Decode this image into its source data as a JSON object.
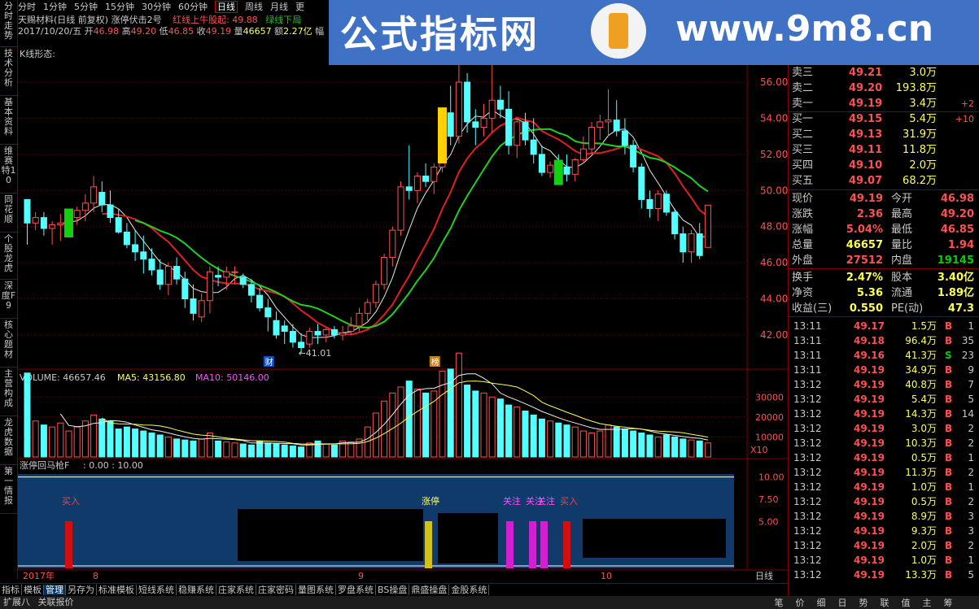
{
  "left_tabs": [
    "分时走势",
    "技术分析",
    "基本资料",
    "维赛特10",
    "同花顺",
    "个股龙虎",
    "深度F9",
    "核心题材",
    "主营构成",
    "龙虎数据",
    "第一情报"
  ],
  "top_menu": [
    "分时",
    "1分钟",
    "5分钟",
    "15分钟",
    "30分钟",
    "60分钟",
    "日线",
    "周线",
    "月线",
    "更"
  ],
  "top_menu_active": 6,
  "title": "天赐材料(日线 前复权) 涨停伏击2号",
  "title_red": "红线上牛股起: 49.88",
  "title_green": "绿线下局",
  "info": {
    "date": "2017/10/20/五",
    "open_l": "开",
    "open": "46.98",
    "high_l": "高",
    "high": "49.20",
    "low_l": "低",
    "low": "46.85",
    "close_l": "收",
    "close": "49.19",
    "vol_l": "量",
    "vol": "46657",
    "amt_l": "额",
    "amt": "2.27亿",
    "amp_l": "幅"
  },
  "kform": "K线形态:",
  "banner": {
    "text1": "公式指标网",
    "text2": "www.9m8.cn"
  },
  "price_axis": [
    "56.00",
    "54.00",
    "52.00",
    "50.00",
    "48.00",
    "46.00",
    "44.00",
    "42.00"
  ],
  "annot": {
    "low_label": "←41.01",
    "cai": "财",
    "bang": "榜"
  },
  "volume_panel": {
    "vol_label": "VOLUME: 46657.46",
    "ma5": "MA5: 43156.80",
    "ma10": "MA10: 50146.00",
    "axis": [
      "30000",
      "20000",
      "10000"
    ],
    "x10": "X10"
  },
  "ind_panel": {
    "name": "涨停回马枪F",
    "values": ": 0.00 : 10.00",
    "axis": [
      "10.00",
      "7.50",
      "5.00"
    ],
    "labels": {
      "buy1": "买入",
      "zt": "涨停",
      "gz1": "关注",
      "gz2": "关注",
      "gz3": "关注",
      "buy2": "买入"
    }
  },
  "date_axis": {
    "y2017": "2017年",
    "m8": "8",
    "m9": "9",
    "m10": "10",
    "right": "日线"
  },
  "quote": {
    "sells": [
      {
        "n": "卖三",
        "p": "49.21",
        "v": "3.0万",
        "d": ""
      },
      {
        "n": "卖二",
        "p": "49.20",
        "v": "193.8万",
        "d": ""
      },
      {
        "n": "卖一",
        "p": "49.19",
        "v": "3.4万",
        "d": "+2"
      }
    ],
    "buys": [
      {
        "n": "买一",
        "p": "49.15",
        "v": "5.4万",
        "d": "+10"
      },
      {
        "n": "买二",
        "p": "49.13",
        "v": "31.9万",
        "d": ""
      },
      {
        "n": "买三",
        "p": "49.11",
        "v": "11.8万",
        "d": ""
      },
      {
        "n": "买四",
        "p": "49.10",
        "v": "2.0万",
        "d": ""
      },
      {
        "n": "买五",
        "p": "49.07",
        "v": "68.2万",
        "d": ""
      }
    ],
    "stats": [
      {
        "l1": "现价",
        "v1": "49.19",
        "c1": "#ff5050",
        "l2": "今开",
        "v2": "46.98",
        "c2": "#ff5050"
      },
      {
        "l1": "涨跌",
        "v1": "2.36",
        "c1": "#ff5050",
        "l2": "最高",
        "v2": "49.20",
        "c2": "#ff5050"
      },
      {
        "l1": "涨幅",
        "v1": "5.04%",
        "c1": "#ff5050",
        "l2": "最低",
        "v2": "46.85",
        "c2": "#ff5050"
      },
      {
        "l1": "总量",
        "v1": "46657",
        "c1": "#ffff54",
        "l2": "量比",
        "v2": "1.94",
        "c2": "#ff5050"
      },
      {
        "l1": "外盘",
        "v1": "27512",
        "c1": "#ff5050",
        "l2": "内盘",
        "v2": "19145",
        "c2": "#00d000"
      },
      {
        "l1": "换手",
        "v1": "2.47%",
        "c1": "#ffff54",
        "l2": "股本",
        "v2": "3.40亿",
        "c2": "#ffff54"
      },
      {
        "l1": "净资",
        "v1": "5.36",
        "c1": "#ffff54",
        "l2": "流通",
        "v2": "1.89亿",
        "c2": "#ffff54"
      },
      {
        "l1": "收益(三)",
        "v1": "0.550",
        "c1": "#ffff54",
        "l2": "PE(动)",
        "v2": "47.3",
        "c2": "#ffff54"
      }
    ],
    "ticks": [
      {
        "t": "13:11",
        "p": "49.17",
        "v": "1.5万",
        "s": "B",
        "c": "1"
      },
      {
        "t": "13:11",
        "p": "49.18",
        "v": "96.4万",
        "s": "B",
        "c": "35"
      },
      {
        "t": "13:11",
        "p": "49.16",
        "v": "41.3万",
        "s": "S",
        "c": "23"
      },
      {
        "t": "13:11",
        "p": "49.19",
        "v": "34.9万",
        "s": "B",
        "c": "9"
      },
      {
        "t": "13:12",
        "p": "49.19",
        "v": "40.8万",
        "s": "B",
        "c": "7"
      },
      {
        "t": "13:12",
        "p": "49.19",
        "v": "5.4万",
        "s": "B",
        "c": "5"
      },
      {
        "t": "13:12",
        "p": "49.19",
        "v": "14.3万",
        "s": "B",
        "c": "14"
      },
      {
        "t": "13:12",
        "p": "49.19",
        "v": "3.0万",
        "s": "B",
        "c": "2"
      },
      {
        "t": "13:12",
        "p": "49.19",
        "v": "10.3万",
        "s": "B",
        "c": "2"
      },
      {
        "t": "13:12",
        "p": "49.19",
        "v": "0.5万",
        "s": "B",
        "c": "1"
      },
      {
        "t": "13:12",
        "p": "49.19",
        "v": "11.3万",
        "s": "B",
        "c": "2"
      },
      {
        "t": "13:12",
        "p": "49.19",
        "v": "1.0万",
        "s": "B",
        "c": "1"
      },
      {
        "t": "13:12",
        "p": "49.19",
        "v": "0.5万",
        "s": "B",
        "c": "2"
      },
      {
        "t": "13:12",
        "p": "49.19",
        "v": "8.9万",
        "s": "B",
        "c": "3"
      },
      {
        "t": "13:12",
        "p": "49.19",
        "v": "9.3万",
        "s": "B",
        "c": "3"
      },
      {
        "t": "13:12",
        "p": "49.19",
        "v": "2.0万",
        "s": "B",
        "c": "2"
      },
      {
        "t": "13:12",
        "p": "49.19",
        "v": "1.0万",
        "s": "B",
        "c": "1"
      },
      {
        "t": "13:12",
        "p": "49.19",
        "v": "13.3万",
        "s": "B",
        "c": "5"
      }
    ]
  },
  "bottom_tabs": [
    "指标",
    "模板",
    "管理",
    "另存为",
    "标准模板",
    "短线系统",
    "稳赚系统",
    "庄家系统",
    "庄家密码",
    "量图系统",
    "罗盘系统",
    "BS操盘",
    "鼎盛操盘",
    "金股系统"
  ],
  "bottom_tab_active": 2,
  "status": [
    "扩展八",
    "关联报价"
  ],
  "right_tabs": [
    "笔",
    "价",
    "细",
    "日",
    "势",
    "联",
    "值",
    "主",
    "筹"
  ],
  "candles": [
    [
      49.5,
      49.5,
      47,
      48.2
    ],
    [
      48.2,
      48.8,
      47.8,
      48.5
    ],
    [
      48.5,
      48.8,
      47.5,
      47.9
    ],
    [
      47.9,
      48.3,
      47.0,
      48.1
    ],
    [
      48.1,
      48.7,
      47.2,
      48.2
    ],
    [
      48.3,
      48.8,
      47.5,
      48.5
    ],
    [
      48.5,
      49.1,
      48.1,
      48.9
    ],
    [
      48.9,
      49.8,
      48.3,
      49.3
    ],
    [
      49.3,
      50.8,
      48.8,
      50.2
    ],
    [
      49.9,
      50.5,
      48.8,
      49.2
    ],
    [
      49.2,
      50.0,
      48.2,
      48.5
    ],
    [
      48.5,
      49.0,
      47.6,
      47.7
    ],
    [
      47.7,
      48.2,
      46.8,
      47.0
    ],
    [
      47.0,
      47.8,
      46.1,
      46.6
    ],
    [
      46.6,
      47.5,
      45.4,
      46.2
    ],
    [
      46.2,
      46.8,
      45.3,
      45.6
    ],
    [
      45.6,
      46.2,
      44.5,
      44.8
    ],
    [
      44.8,
      46.0,
      44.2,
      45.8
    ],
    [
      45.8,
      46.3,
      44.8,
      45.1
    ],
    [
      45.1,
      45.5,
      43.5,
      44.0
    ],
    [
      44.0,
      44.8,
      42.8,
      43.2
    ],
    [
      43.0,
      44.3,
      42.7,
      43.9
    ],
    [
      43.9,
      45.8,
      43.2,
      45.5
    ],
    [
      45.3,
      45.8,
      44.7,
      45.2
    ],
    [
      45.2,
      45.8,
      44.5,
      45.5
    ],
    [
      45.5,
      45.8,
      44.8,
      45.5
    ],
    [
      45.2,
      45.4,
      44.6,
      44.8
    ],
    [
      44.8,
      45.1,
      43.8,
      44.2
    ],
    [
      44.2,
      44.6,
      43.3,
      43.5
    ],
    [
      43.5,
      44.0,
      42.2,
      43.0
    ],
    [
      42.8,
      43.3,
      41.8,
      42.0
    ],
    [
      42.5,
      42.8,
      41.5,
      42.2
    ],
    [
      42.2,
      42.6,
      41.3,
      41.6
    ],
    [
      41.6,
      42.1,
      41.0,
      41.3
    ],
    [
      41.5,
      42.4,
      41.3,
      42.2
    ],
    [
      42.2,
      42.6,
      41.5,
      42.0
    ],
    [
      42.0,
      42.4,
      41.6,
      42.3
    ],
    [
      42.3,
      42.5,
      41.8,
      42.0
    ],
    [
      42.0,
      42.5,
      41.7,
      42.1
    ],
    [
      42.2,
      43.0,
      42.0,
      42.5
    ],
    [
      42.5,
      43.5,
      42.2,
      43.2
    ],
    [
      43.2,
      44.0,
      42.8,
      43.8
    ],
    [
      43.8,
      45.0,
      43.5,
      44.8
    ],
    [
      44.8,
      46.5,
      44.5,
      46.3
    ],
    [
      46.3,
      48.0,
      45.8,
      47.8
    ],
    [
      47.8,
      50.5,
      47.5,
      50.2
    ],
    [
      50.2,
      52.5,
      49.5,
      50.0
    ],
    [
      50.0,
      51.0,
      49.3,
      50.8
    ],
    [
      50.8,
      51.5,
      50.2,
      50.5
    ],
    [
      50.5,
      51.5,
      49.8,
      51.3
    ],
    [
      51.3,
      54.5,
      51.0,
      54.3
    ],
    [
      54.3,
      55.8,
      52.5,
      53.0
    ],
    [
      53.0,
      57.2,
      52.6,
      56.0
    ],
    [
      56.0,
      56.5,
      53.2,
      53.8
    ],
    [
      53.8,
      54.5,
      52.5,
      53.5
    ],
    [
      53.5,
      54.8,
      53.0,
      54.0
    ],
    [
      54.0,
      57.0,
      53.2,
      55.0
    ],
    [
      55.0,
      55.8,
      54.0,
      54.5
    ],
    [
      54.5,
      55.5,
      52.0,
      52.5
    ],
    [
      52.5,
      54.0,
      51.8,
      53.8
    ],
    [
      53.8,
      54.3,
      52.5,
      52.8
    ],
    [
      52.8,
      54.0,
      51.5,
      52.0
    ],
    [
      52.0,
      52.5,
      50.8,
      51.0
    ],
    [
      51.0,
      51.6,
      50.7,
      51.4
    ],
    [
      51.4,
      52.0,
      51.0,
      51.3
    ],
    [
      51.3,
      52.0,
      50.5,
      50.9
    ],
    [
      50.9,
      51.8,
      50.5,
      51.7
    ],
    [
      51.7,
      53.0,
      51.5,
      52.3
    ],
    [
      52.3,
      53.8,
      52.0,
      53.5
    ],
    [
      53.5,
      54.2,
      52.8,
      53.8
    ],
    [
      53.8,
      55.6,
      53.0,
      53.9
    ],
    [
      53.9,
      55.0,
      53.0,
      53.3
    ],
    [
      53.3,
      54.0,
      52.0,
      52.5
    ],
    [
      52.5,
      52.8,
      51.0,
      51.3
    ],
    [
      51.3,
      51.5,
      49.0,
      49.5
    ],
    [
      49.5,
      50.0,
      48.5,
      49.0
    ],
    [
      49.0,
      50.0,
      48.3,
      49.8
    ],
    [
      49.8,
      50.0,
      48.6,
      48.8
    ],
    [
      48.8,
      49.0,
      47.3,
      47.6
    ],
    [
      47.6,
      48.0,
      46.0,
      46.6
    ],
    [
      46.6,
      47.8,
      46.0,
      47.6
    ],
    [
      47.6,
      48.2,
      46.2,
      46.4
    ],
    [
      46.85,
      49.2,
      46.85,
      49.19
    ]
  ],
  "volumes": [
    4200,
    1800,
    1600,
    1500,
    1700,
    1300,
    1500,
    1800,
    2100,
    1900,
    1800,
    1400,
    1500,
    1400,
    1300,
    1200,
    1100,
    1000,
    900,
    850,
    800,
    900,
    1200,
    800,
    750,
    700,
    650,
    600,
    800,
    700,
    650,
    600,
    550,
    500,
    700,
    800,
    650,
    600,
    800,
    750,
    900,
    1500,
    2200,
    2800,
    3200,
    3500,
    3800,
    3400,
    3200,
    3300,
    4300,
    4400,
    5200,
    3600,
    3300,
    3200,
    3000,
    2900,
    2600,
    2500,
    2300,
    2100,
    1900,
    1800,
    1700,
    1600,
    1500,
    1300,
    1200,
    1300,
    1600,
    1500,
    1400,
    1300,
    1200,
    1100,
    1000,
    1100,
    1000,
    900,
    850,
    800,
    700
  ],
  "signals": [
    {
      "i": 4,
      "color": "#d01010",
      "label": "buy1"
    },
    {
      "i": 37,
      "color": "#d0c020",
      "label": "zt"
    },
    {
      "i": 44,
      "color": "#d020d0",
      "label": "gz1"
    },
    {
      "i": 46,
      "color": "#d020d0",
      "label": "gz2"
    },
    {
      "i": 47,
      "color": "#d020d0",
      "label": "gz3"
    },
    {
      "i": 49,
      "color": "#d01010",
      "label": "buy2"
    }
  ]
}
